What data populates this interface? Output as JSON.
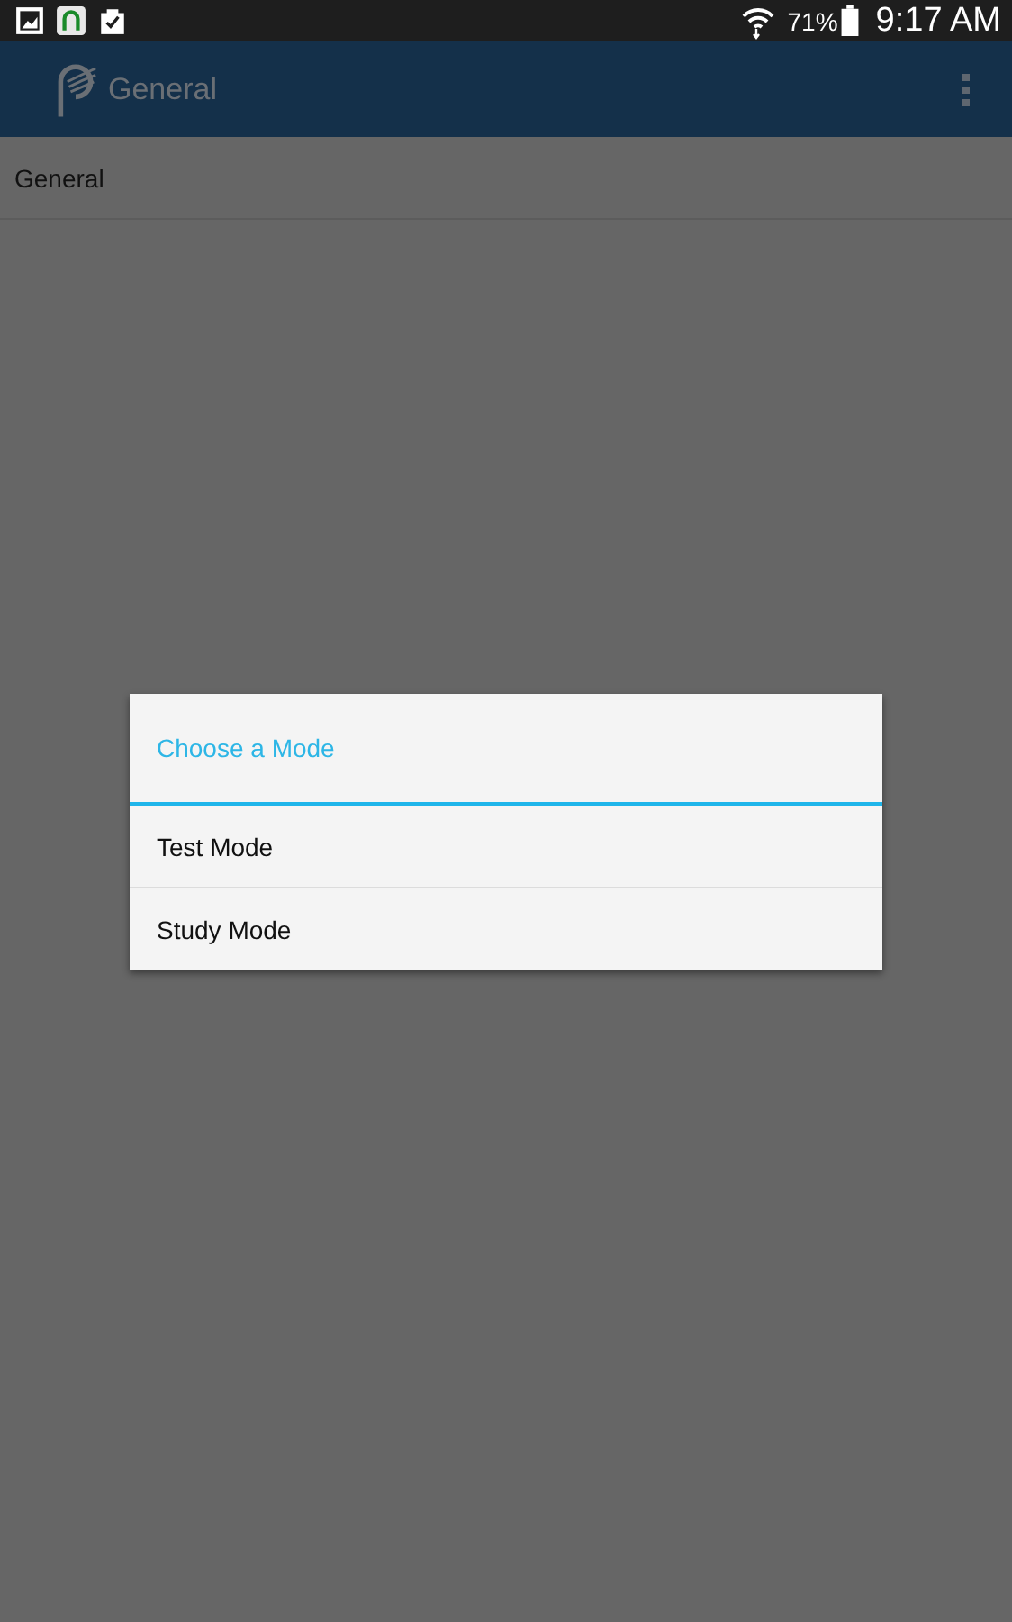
{
  "status_bar": {
    "battery": "71%",
    "time": "9:17 AM"
  },
  "app_bar": {
    "title": "General"
  },
  "list": [
    {
      "label": "General"
    }
  ],
  "dialog": {
    "title": "Choose a Mode",
    "options": [
      {
        "label": "Test Mode"
      },
      {
        "label": "Study Mode"
      }
    ]
  }
}
